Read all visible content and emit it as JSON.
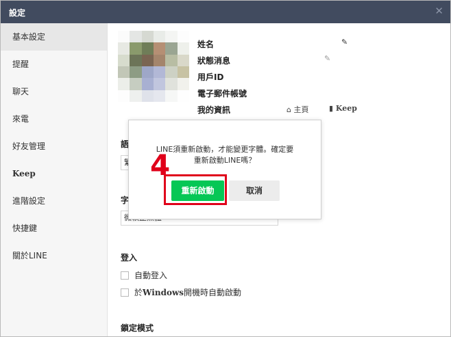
{
  "window": {
    "title": "設定",
    "close_icon": "close-icon"
  },
  "sidebar": {
    "items": [
      {
        "label": "基本設定"
      },
      {
        "label": "提醒"
      },
      {
        "label": "聊天"
      },
      {
        "label": "來電"
      },
      {
        "label": "好友管理"
      },
      {
        "label": "Keep"
      },
      {
        "label": "進階設定"
      },
      {
        "label": "快捷鍵"
      },
      {
        "label": "關於LINE"
      }
    ]
  },
  "profile": {
    "name_label": "姓名",
    "status_label": "狀態消息",
    "user_id_label": "用戶ID",
    "email_label": "電子郵件帳號",
    "my_info_label": "我的資訊",
    "home_link": "主頁",
    "keep_link": "Keep"
  },
  "sections": {
    "language_title": "語",
    "language_value": "繁",
    "font_title": "字",
    "font_value": "微軟正黑體",
    "login_title": "登入",
    "auto_login": "自動登入",
    "auto_start_prefix": "於",
    "auto_start_windows": "Windows",
    "auto_start_suffix": "開機時自動啟動",
    "lock_title": "鎖定模式"
  },
  "dialog": {
    "message_line1": "LINE須重新啟動，才能變更字體。確定要",
    "message_line2": "重新啟動LINE嗎？",
    "confirm_label": "重新啟動",
    "cancel_label": "取消"
  },
  "annotation": {
    "step_number": "4",
    "color": "#e0001a"
  },
  "colors": {
    "titlebar": "#414b5f",
    "accent": "#06c755"
  }
}
